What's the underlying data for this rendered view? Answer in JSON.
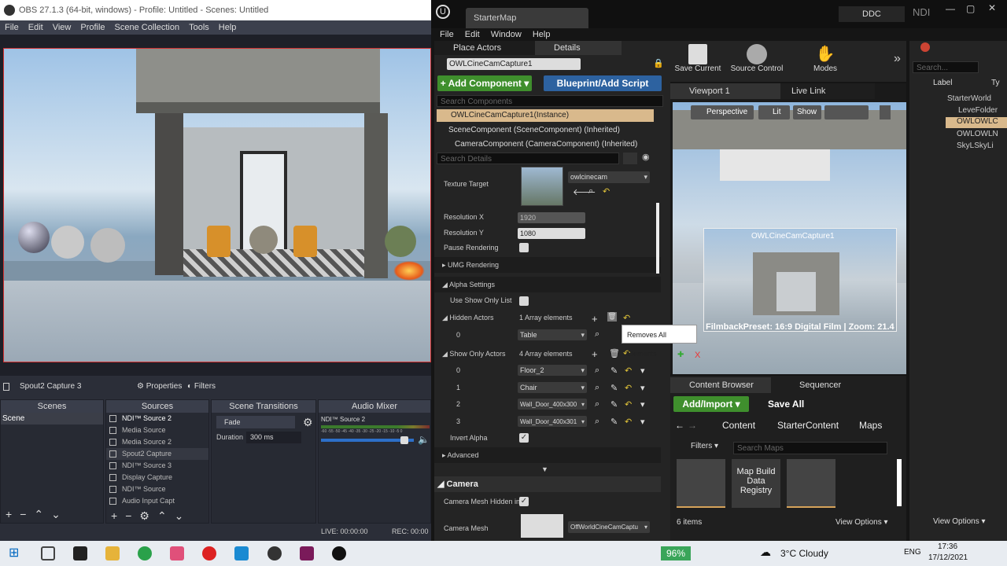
{
  "obs": {
    "title": "OBS 27.1.3 (64-bit, windows) - Profile: Untitled - Scenes: Untitled",
    "menu": [
      "File",
      "Edit",
      "View",
      "Profile",
      "Scene Collection",
      "Tools",
      "Help"
    ],
    "selected_source": "Spout2 Capture 3",
    "properties_label": "Properties",
    "filters_label": "Filters",
    "docks": {
      "scenes": "Scenes",
      "sources": "Sources",
      "transitions": "Scene Transitions",
      "mixer": "Audio Mixer"
    },
    "scenes": [
      "Scene"
    ],
    "sources": [
      "NDI™ Source 2",
      "Media Source",
      "Media Source 2",
      "Spout2 Capture",
      "NDI™ Source 3",
      "Display Capture",
      "NDI™ Source",
      "Audio Input Capt"
    ],
    "transition": {
      "type": "Fade",
      "duration_label": "Duration",
      "duration": "300 ms"
    },
    "mixer": {
      "channel": "NDI™ Source 2",
      "scale": "-60 -55 -50 -45 -40 -35 -30 -25 -20 -15 -10 -5 0"
    },
    "status": {
      "live": "LIVE: 00:00:00",
      "rec": "REC: 00:00"
    }
  },
  "ue": {
    "tab_title": "StarterMap",
    "ddc": "DDC",
    "ndi": "NDI",
    "menu": [
      "File",
      "Edit",
      "Window",
      "Help"
    ],
    "tabs": {
      "place": "Place Actors",
      "details": "Details"
    },
    "actor_name": "OWLCineCamCapture1",
    "add_component": "+ Add Component ▾",
    "blueprint": "Blueprint/Add Script",
    "search_components": "Search Components",
    "components": [
      "OWLCineCamCapture1(Instance)",
      "SceneComponent (SceneComponent) (Inherited)",
      "CameraComponent (CameraComponent) (Inherited)"
    ],
    "search_details": "Search Details",
    "props": {
      "texture_target": "Texture Target",
      "texture_value": "owlcinecam",
      "res_x": "Resolution X",
      "res_x_val": "1920",
      "res_y": "Resolution Y",
      "res_y_val": "1080",
      "pause": "Pause Rendering",
      "umg": "UMG Rendering",
      "alpha": "Alpha Settings",
      "use_show_only": "Use Show Only List",
      "hidden_actors": "Hidden Actors",
      "hidden_count": "1 Array elements",
      "hidden_items": [
        {
          "idx": "0",
          "val": "Table"
        }
      ],
      "show_only": "Show Only Actors",
      "show_count": "4 Array elements",
      "show_items": [
        {
          "idx": "0",
          "val": "Floor_2"
        },
        {
          "idx": "1",
          "val": "Chair"
        },
        {
          "idx": "2",
          "val": "Wall_Door_400x300"
        },
        {
          "idx": "3",
          "val": "Wall_Door_400x301"
        }
      ],
      "invert_alpha": "Invert Alpha",
      "advanced": "Advanced",
      "camera_section": "Camera",
      "camera_mesh_hidden": "Camera Mesh Hidden in",
      "camera_mesh": "Camera Mesh",
      "camera_mesh_val": "OffWorldCineCamCaptu"
    },
    "tooltip": "Removes All Elements",
    "toolbar": {
      "save": "Save Current",
      "source_control": "Source Control",
      "modes": "Modes"
    },
    "viewport": {
      "tab": "Viewport 1",
      "live_link": "Live Link",
      "perspective": "Perspective",
      "lit": "Lit",
      "show": "Show",
      "overlay_title": "OWLCineCamCapture1",
      "overlay_caption": "FilmbackPreset: 16:9 Digital Film | Zoom: 21.4"
    },
    "content_browser": {
      "tab": "Content Browser",
      "sequencer": "Sequencer",
      "add_import": "Add/Import ▾",
      "save_all": "Save All",
      "path": [
        "Content",
        "StarterContent",
        "Maps"
      ],
      "filters": "Filters ▾",
      "search": "Search Maps",
      "items": [
        "",
        "Map Build Data Registry",
        ""
      ],
      "count": "6 items",
      "view_options": "View Options ▾"
    },
    "outliner": {
      "search": "Search...",
      "col_label": "Label",
      "col_type": "Ty",
      "items": [
        "StarterWorld",
        "LeveFolder",
        "OWLOWLC",
        "OWLOWLN",
        "SkyLSkyLi"
      ],
      "view_options": "View Options ▾"
    }
  },
  "taskbar": {
    "battery": "96%",
    "weather": "3°C Cloudy",
    "lang": "ENG",
    "time": "17:36",
    "date": "17/12/2021"
  }
}
